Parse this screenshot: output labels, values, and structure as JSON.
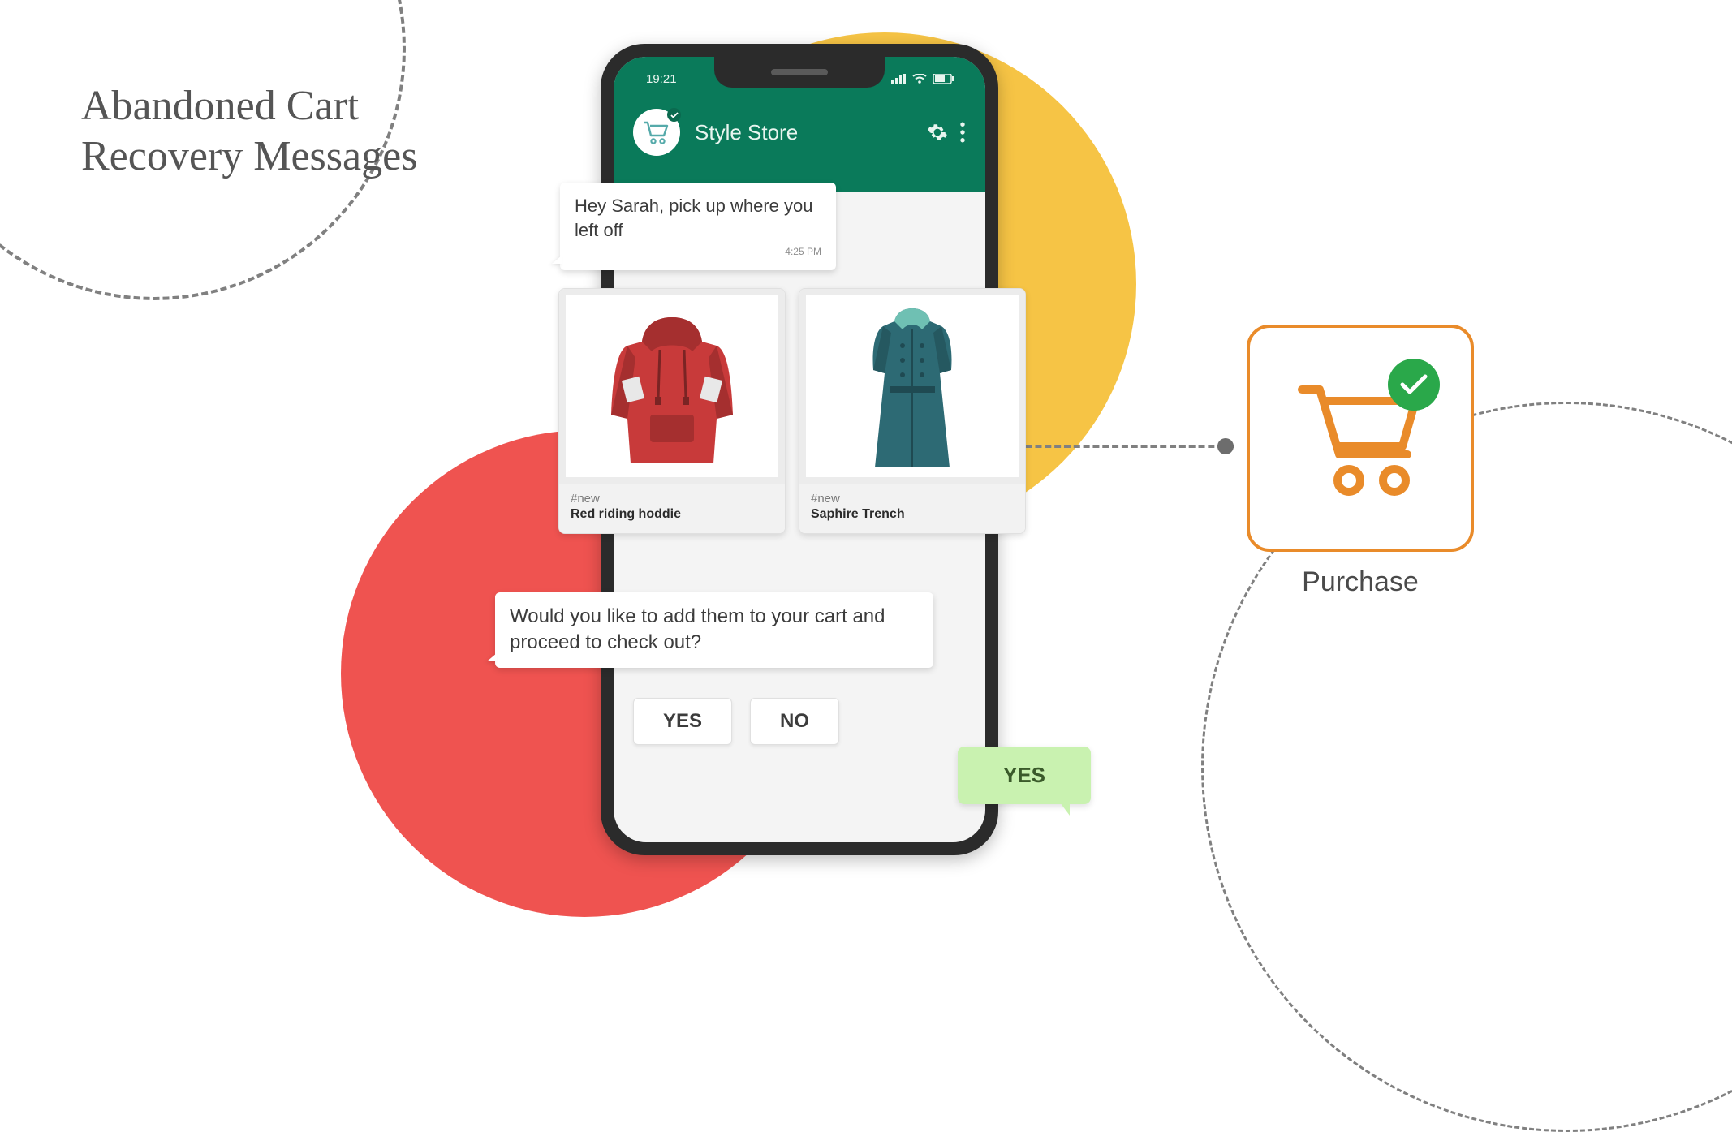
{
  "heading": "Abandoned Cart\nRecovery Messages",
  "phone": {
    "status_time": "19:21",
    "store_name": "Style Store"
  },
  "messages": {
    "greeting": "Hey Sarah, pick up where you left off",
    "greeting_time": "4:25 PM",
    "prompt": "Would you like to add them to your cart and proceed to check out?"
  },
  "products": [
    {
      "tag": "#new",
      "title": "Red riding hoddie"
    },
    {
      "tag": "#new",
      "title": "Saphire Trench"
    }
  ],
  "buttons": {
    "yes": "YES",
    "no": "NO"
  },
  "reply": "YES",
  "purchase_label": "Purchase"
}
